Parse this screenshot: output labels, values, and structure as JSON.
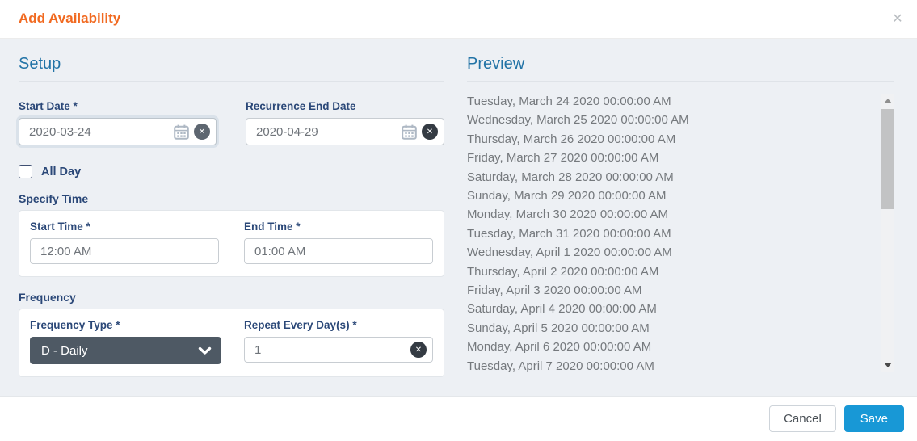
{
  "modal": {
    "title": "Add Availability",
    "close_glyph": "✕"
  },
  "setup": {
    "heading": "Setup",
    "start_date": {
      "label": "Start Date *",
      "value": "2020-03-24"
    },
    "recurrence_end_date": {
      "label": "Recurrence End Date",
      "value": "2020-04-29"
    },
    "all_day": {
      "label": "All Day",
      "checked": false
    },
    "specify_time": {
      "heading": "Specify Time",
      "start_time": {
        "label": "Start Time *",
        "value": "12:00 AM"
      },
      "end_time": {
        "label": "End Time *",
        "value": "01:00 AM"
      }
    },
    "frequency": {
      "heading": "Frequency",
      "frequency_type": {
        "label": "Frequency Type *",
        "value": "D - Daily"
      },
      "repeat_every": {
        "label": "Repeat Every Day(s) *",
        "value": "1"
      }
    }
  },
  "preview": {
    "heading": "Preview",
    "items": [
      "Tuesday, March 24 2020 00:00:00 AM",
      "Wednesday, March 25 2020 00:00:00 AM",
      "Thursday, March 26 2020 00:00:00 AM",
      "Friday, March 27 2020 00:00:00 AM",
      "Saturday, March 28 2020 00:00:00 AM",
      "Sunday, March 29 2020 00:00:00 AM",
      "Monday, March 30 2020 00:00:00 AM",
      "Tuesday, March 31 2020 00:00:00 AM",
      "Wednesday, April 1 2020 00:00:00 AM",
      "Thursday, April 2 2020 00:00:00 AM",
      "Friday, April 3 2020 00:00:00 AM",
      "Saturday, April 4 2020 00:00:00 AM",
      "Sunday, April 5 2020 00:00:00 AM",
      "Monday, April 6 2020 00:00:00 AM",
      "Tuesday, April 7 2020 00:00:00 AM"
    ]
  },
  "footer": {
    "cancel_label": "Cancel",
    "save_label": "Save"
  },
  "icons": {
    "clear_glyph": "✕"
  },
  "colors": {
    "title_orange": "#f16a21",
    "heading_blue": "#2273a6",
    "label_navy": "#2b4878",
    "body_background": "#edf0f4",
    "dropdown_slate": "#4e5964",
    "save_blue": "#1898d6",
    "preview_text": "#75797d"
  }
}
